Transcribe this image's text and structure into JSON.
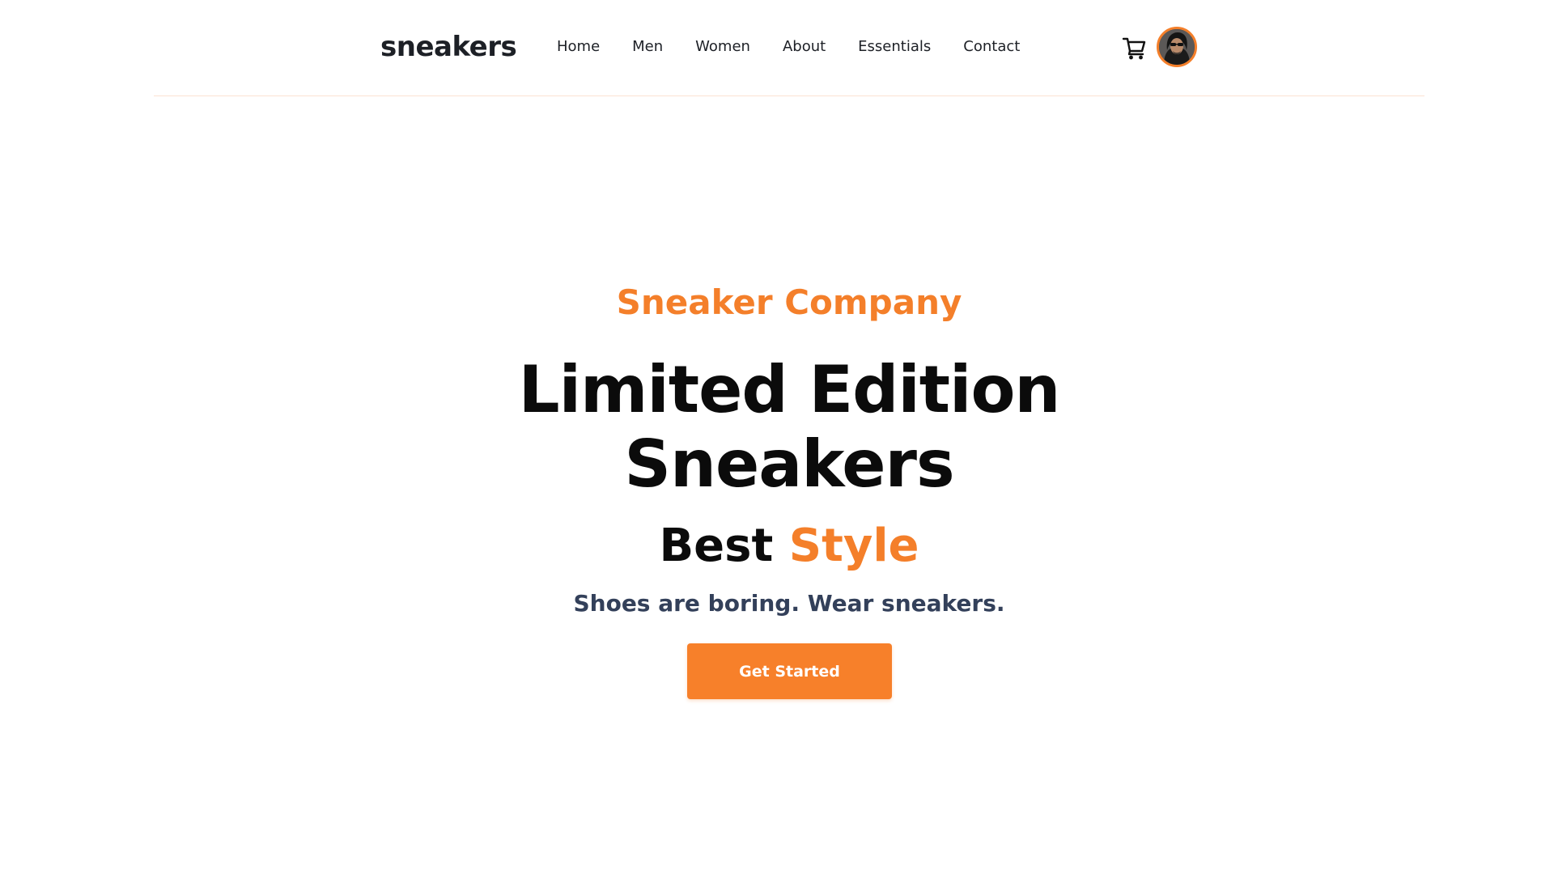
{
  "header": {
    "logo": "sneakers",
    "nav": [
      {
        "label": "Home"
      },
      {
        "label": "Men"
      },
      {
        "label": "Women"
      },
      {
        "label": "About"
      },
      {
        "label": "Essentials"
      },
      {
        "label": "Contact"
      }
    ],
    "cart_icon": "cart-icon",
    "avatar_icon": "user-avatar"
  },
  "hero": {
    "eyebrow": "Sneaker Company",
    "headline_line1": "Limited Edition",
    "headline_line2": "Sneakers",
    "subhead_prefix": "Best",
    "subhead_accent": "Style",
    "tagline": "Shoes are boring. Wear sneakers.",
    "cta_label": "Get Started"
  },
  "colors": {
    "accent": "#f47f2a",
    "text_dark": "#0b0b0b",
    "tagline": "#33405a",
    "divider": "#fbe3d2"
  }
}
